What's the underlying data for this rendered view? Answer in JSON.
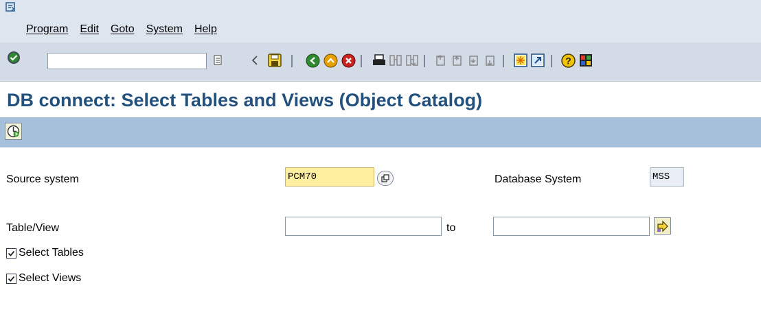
{
  "menu": [
    "Program",
    "Edit",
    "Goto",
    "System",
    "Help"
  ],
  "toolbar": {
    "command_value": "",
    "icons": [
      "enter-icon",
      "history-icon",
      "back-triangle-icon",
      "save-icon",
      "back-icon",
      "exit-icon",
      "cancel-icon",
      "print-icon",
      "find-icon",
      "find-next-icon",
      "first-page-icon",
      "previous-page-icon",
      "next-page-icon",
      "last-page-icon",
      "create-session-icon",
      "shortcut-icon",
      "help-icon",
      "layout-icon"
    ]
  },
  "title": "DB connect: Select Tables and Views (Object Catalog)",
  "app_toolbar": {
    "execute_icon": "execute-icon"
  },
  "form": {
    "source_system_label": "Source system",
    "source_system_value": "PCM70",
    "database_system_label": "Database System",
    "database_system_value": "MSS",
    "table_view_label": "Table/View",
    "table_view_from": "",
    "to_label": "to",
    "table_view_to": "",
    "select_tables_label": "Select Tables",
    "select_tables_checked": true,
    "select_views_label": "Select Views",
    "select_views_checked": true
  },
  "colors": {
    "title": "#24507c",
    "menu_bg": "#dde5ee",
    "toolbar_bg": "#d3dbe6",
    "app_toolbar_bg": "#a6c0dc",
    "required_field": "#ffef9e"
  }
}
